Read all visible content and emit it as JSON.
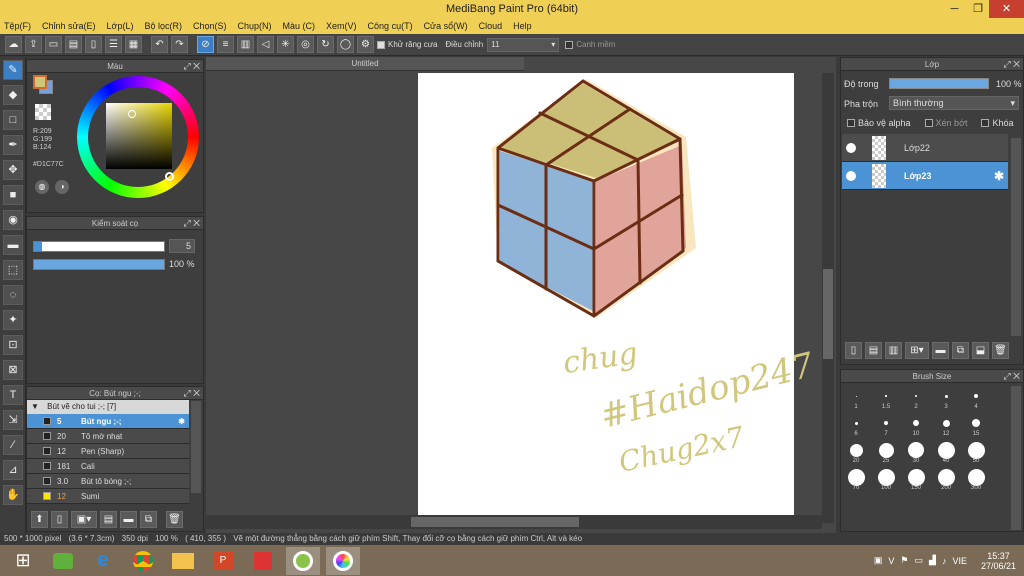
{
  "app": {
    "title": "MediBang Paint Pro (64bit)",
    "minimize": "─",
    "maximize": "❐",
    "close": "✕"
  },
  "menu": [
    "Tệp(F)",
    "Chỉnh sửa(E)",
    "Lớp(L)",
    "Bộ lọc(R)",
    "Chọn(S)",
    "Chụp(N)",
    "Màu (C)",
    "Xem(V)",
    "Công cụ(T)",
    "Cửa sổ(W)",
    "Cloud",
    "Help"
  ],
  "toolbar": {
    "antialias_label": "Khử răng cưa",
    "adjust_label": "Điều chỉnh",
    "adjust_value": "11",
    "smooth_label": "Canh mềm"
  },
  "color_panel": {
    "title": "Màu",
    "r": "R:209",
    "g": "G:199",
    "b": "B:124",
    "hex": "#D1C77C",
    "primary": "#d1c77c",
    "secondary": "#7a9fd6"
  },
  "brush_control": {
    "title": "Kiểm soát cọ",
    "size": "5",
    "opacity": "100 %",
    "size_fraction": 0.06,
    "opacity_fraction": 1.0
  },
  "brush_panel": {
    "title": "Cọ: Bút ngu ;-;",
    "group": "Bút vẽ cho tui ;-; [7]",
    "items": [
      {
        "size": "5",
        "name": "Bút ngu ;-;",
        "selected": true,
        "color": "#222222"
      },
      {
        "size": "20",
        "name": "Tô mờ nhạt",
        "color": "#222222"
      },
      {
        "size": "12",
        "name": "Pen (Sharp)",
        "color": "#222222"
      },
      {
        "size": "181",
        "name": "Cali",
        "color": "#222222"
      },
      {
        "size": "3.0",
        "name": "Bút tô bóng ;-;",
        "color": "#222222"
      },
      {
        "size": "12",
        "name": "Sumi",
        "color": "#ffe000"
      }
    ]
  },
  "canvas": {
    "tab": "Untitled",
    "text_line1": "chug",
    "text_line2": "#Haidop247",
    "text_line3": "Chug2x7"
  },
  "layer_panel": {
    "title": "Lớp",
    "opacity_label": "Độ trong",
    "opacity_value": "100 %",
    "blend_label": "Pha trộn",
    "blend_value": "Bình thường",
    "protect_alpha": "Bảo vệ alpha",
    "clipping": "Xén bớt",
    "lock": "Khóa",
    "layers": [
      {
        "name": "Lớp22",
        "selected": false
      },
      {
        "name": "Lớp23",
        "selected": true
      }
    ]
  },
  "brush_size_panel": {
    "title": "Brush Size",
    "sizes": [
      "1",
      "1.5",
      "2",
      "3",
      "4",
      "6",
      "7",
      "10",
      "12",
      "15",
      "20",
      "25",
      "30",
      "40",
      "50",
      "70",
      "100",
      "150",
      "200",
      "300"
    ]
  },
  "status": {
    "dims": "500 * 1000 pixel",
    "physical": "(3.6 * 7.3cm)",
    "dpi": "350 dpi",
    "zoom": "100 %",
    "coords": "( 410, 355 )",
    "hint": "Vẽ một đường thẳng bằng cách giữ phím Shift, Thay đổi cỡ cọ bằng cách giữ phím Ctrl, Alt và kéo"
  },
  "taskbar": {
    "lang": "VIE",
    "time": "15:37",
    "date": "27/06/21"
  }
}
